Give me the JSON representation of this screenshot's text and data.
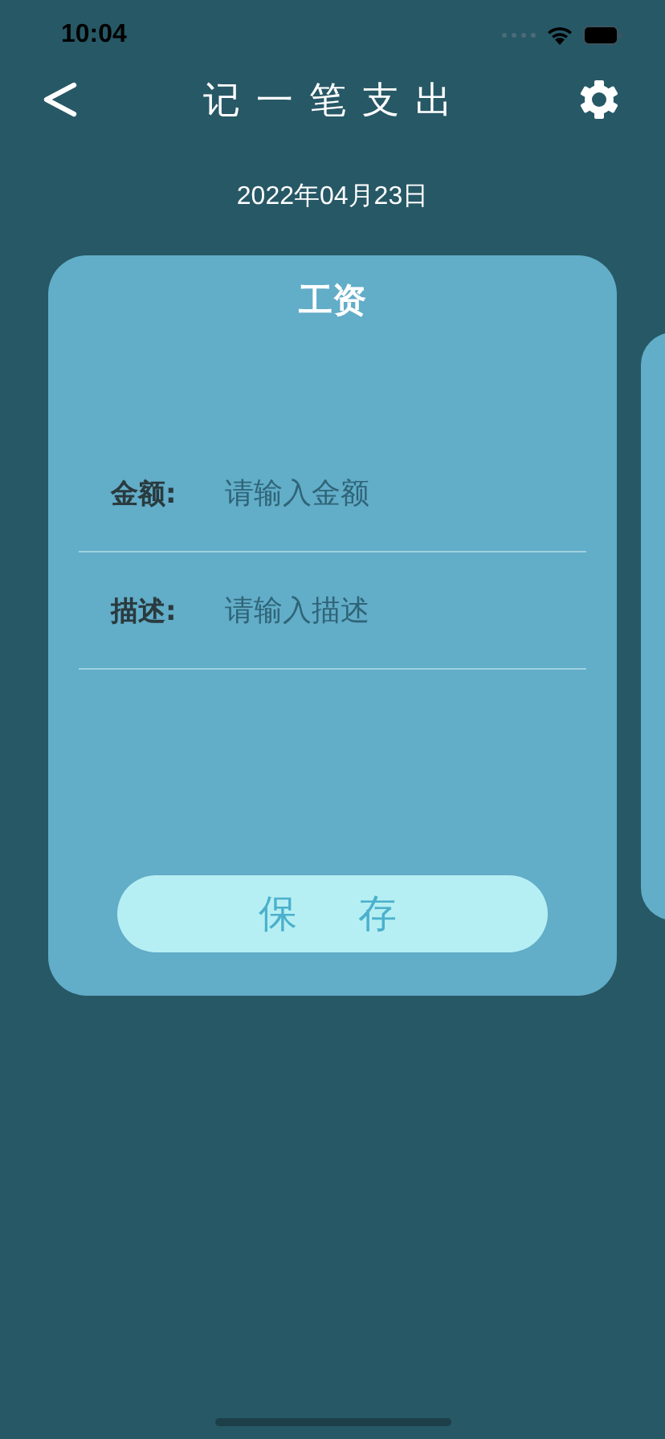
{
  "status_bar": {
    "time": "10:04"
  },
  "nav": {
    "title": "记一笔支出"
  },
  "date": "2022年04月23日",
  "card": {
    "title": "工资",
    "fields": [
      {
        "label": "金额:",
        "placeholder": "请输入金额"
      },
      {
        "label": "描述:",
        "placeholder": "请输入描述"
      }
    ],
    "save_button": "保存"
  }
}
